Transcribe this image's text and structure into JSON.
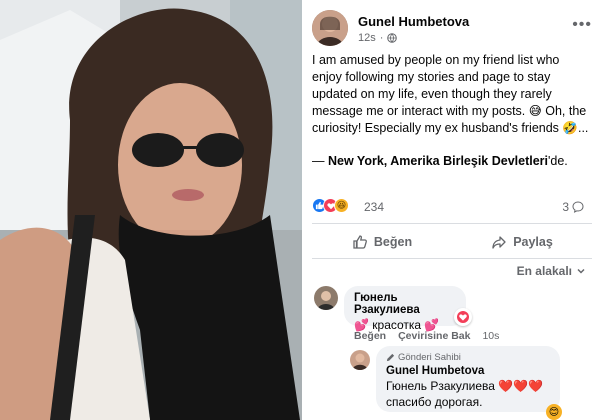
{
  "post": {
    "author": "Gunel Humbetova",
    "time": "12s",
    "more": "•••",
    "body": "I am amused by people on my friend list who enjoy following my stories and page to stay updated on my life, even though they rarely message me or interact with my posts. 😅 Oh, the curiosity! Especially my ex husband's friends 🤣...",
    "location_prefix": "— ",
    "location_bold": "New York, Amerika Birleşik Devletleri",
    "location_suffix": "'de.",
    "reaction_icons": [
      "like-icon",
      "love-icon",
      "haha-icon"
    ],
    "reaction_count": "234",
    "comment_count": "3",
    "like_label": "Beğen",
    "share_label": "Paylaş",
    "sort_label": "En alakalı"
  },
  "comments": [
    {
      "name": "Гюнель Рзакулиева",
      "text": "💕 красотка 💕",
      "like_label": "Beğen",
      "translate_label": "Çevirisine Bak",
      "time": "10s",
      "reaction": "heart"
    },
    {
      "author_tag": "Gönderi Sahibi",
      "name": "Gunel Humbetova",
      "mention": "Гюнель Рзакулиева",
      "hearts": "❤️❤️❤️",
      "text": "спасибо дорогая.",
      "reaction": "smile"
    }
  ],
  "colors": {
    "accent": "#1877f2",
    "love": "#f33e58",
    "haha": "#f7b125",
    "muted": "#65676b",
    "bubble": "#f0f2f5"
  }
}
